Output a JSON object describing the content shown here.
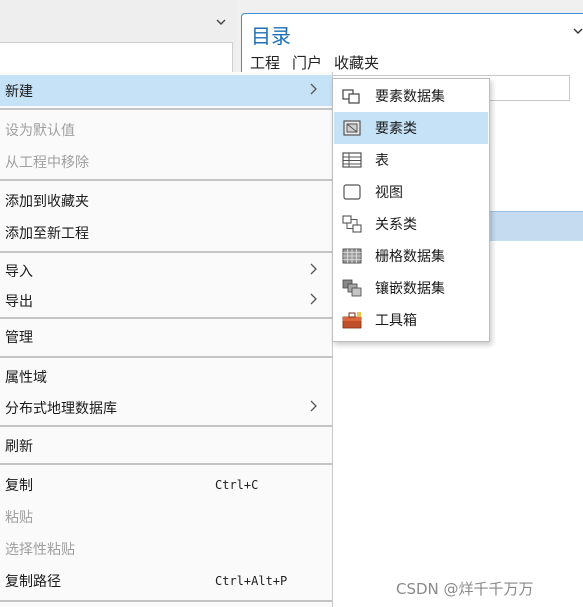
{
  "catalog": {
    "title": "目录",
    "tabs": [
      "工程",
      "门户",
      "收藏夹"
    ]
  },
  "menu": {
    "items": [
      {
        "label": "新建",
        "disabled": false,
        "submenu": true
      },
      {
        "label": "设为默认值",
        "disabled": true
      },
      {
        "label": "从工程中移除",
        "disabled": true
      },
      {
        "label": "添加到收藏夹",
        "disabled": false
      },
      {
        "label": "添加至新工程",
        "disabled": false
      },
      {
        "label": "导入",
        "disabled": false,
        "submenu": true
      },
      {
        "label": "导出",
        "disabled": false,
        "submenu": true
      },
      {
        "label": "管理",
        "disabled": false
      },
      {
        "label": "属性域",
        "disabled": false
      },
      {
        "label": "分布式地理数据库",
        "disabled": false,
        "submenu": true
      },
      {
        "label": "刷新",
        "disabled": false
      },
      {
        "label": "复制",
        "disabled": false,
        "shortcut": "Ctrl+C"
      },
      {
        "label": "粘贴",
        "disabled": true
      },
      {
        "label": "选择性粘贴",
        "disabled": true
      },
      {
        "label": "复制路径",
        "disabled": false,
        "shortcut": "Ctrl+Alt+P"
      }
    ]
  },
  "submenu": {
    "items": [
      {
        "label": "要素数据集",
        "icon": "feature-dataset-icon"
      },
      {
        "label": "要素类",
        "icon": "feature-class-icon"
      },
      {
        "label": "表",
        "icon": "table-icon"
      },
      {
        "label": "视图",
        "icon": "view-icon"
      },
      {
        "label": "关系类",
        "icon": "relationship-class-icon"
      },
      {
        "label": "栅格数据集",
        "icon": "raster-dataset-icon"
      },
      {
        "label": "镶嵌数据集",
        "icon": "mosaic-dataset-icon"
      },
      {
        "label": "工具箱",
        "icon": "toolbox-icon"
      }
    ]
  },
  "watermark": "CSDN @烊千千万万",
  "colors": {
    "hover": "#c6e2f7",
    "accent": "#1f6fb5"
  }
}
